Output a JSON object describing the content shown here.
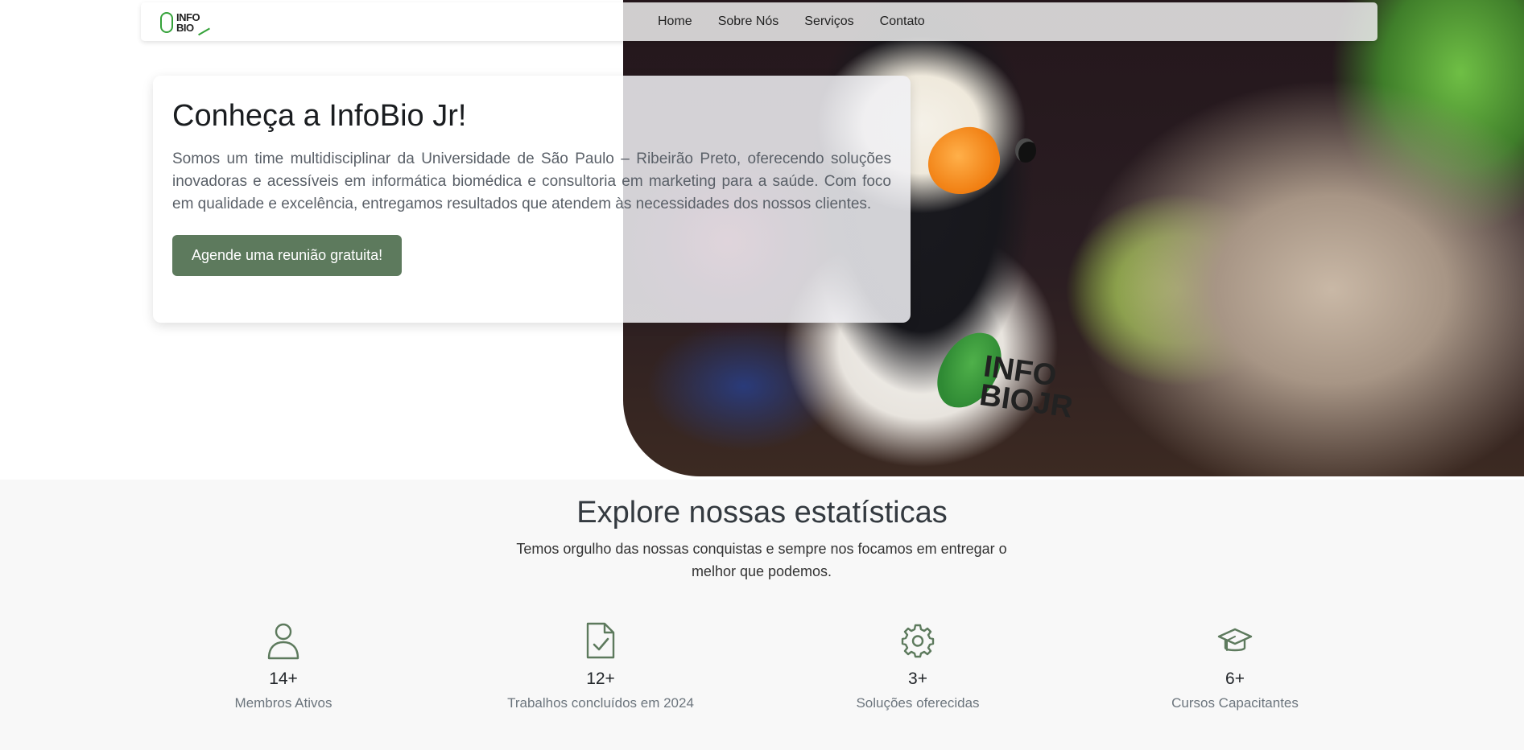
{
  "nav": {
    "brand_lines": [
      "INFO",
      "BIO"
    ],
    "links": [
      "Home",
      "Sobre Nós",
      "Serviços",
      "Contato"
    ]
  },
  "hero": {
    "title": "Conheça a InfoBio Jr!",
    "text": "Somos um time multidisciplinar da Universidade de São Paulo – Ribeirão Preto, oferecendo soluções inovadoras e acessíveis em informática biomédica e consultoria em marketing para a saúde. Com foco em qualidade e excelência, entregamos resultados que atendem às necessidades dos nossos clientes.",
    "cta": "Agende uma reunião gratuita!",
    "image_shirt_text": [
      "INFO",
      "BIOJR"
    ]
  },
  "stats": {
    "title": "Explore nossas estatísticas",
    "subtitle": "Temos orgulho das nossas conquistas e sempre nos focamos em entregar o melhor que podemos.",
    "items": [
      {
        "icon": "person-icon",
        "value": "14+",
        "label": "Membros Ativos"
      },
      {
        "icon": "document-check-icon",
        "value": "12+",
        "label": "Trabalhos concluídos em 2024"
      },
      {
        "icon": "gear-icon",
        "value": "3+",
        "label": "Soluções oferecidas"
      },
      {
        "icon": "graduation-cap-icon",
        "value": "6+",
        "label": "Cursos Capacitantes"
      }
    ]
  },
  "colors": {
    "accent_green": "#5d7a5d",
    "brand_green": "#35a23a",
    "icon_green": "#5d7a5d"
  }
}
